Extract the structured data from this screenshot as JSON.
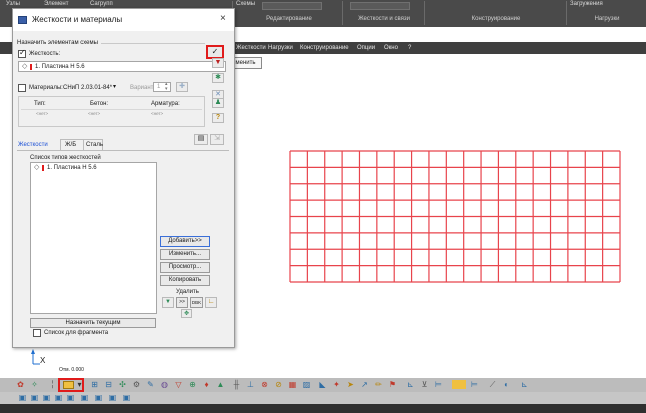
{
  "ribbon": {
    "menu": [
      "Узлы",
      "Элемент",
      "Сагрупп"
    ],
    "schemes_label": "Схемы",
    "loadings_label": "Загружения",
    "captions": [
      "Редактирование",
      "Жесткости и связи",
      "Конструирование",
      "Нагрузки"
    ]
  },
  "menubar": {
    "items": [
      "Жесткости",
      "Нагрузки",
      "Конструирование",
      "Опции",
      "Окно",
      "?"
    ]
  },
  "tooltip": {
    "text": "Применить"
  },
  "dialog": {
    "title": "Жесткости и материалы",
    "close_glyph": "×",
    "assign_section_label": "Назначить элементам схемы",
    "stiffness_checkbox_label": "Жесткость:",
    "stiffness_checked": true,
    "stiffness_field_value": "1. Пластина  H 5.6",
    "materials_checkbox_label": "Материалы:",
    "materials_checked": false,
    "norms_select_value": "СНиП 2.03.01-84*",
    "variant_label": "Вариант",
    "variant_value": "1",
    "materials_table": {
      "headers": [
        "Тип:",
        "Бетон:",
        "Арматура:"
      ],
      "values": [
        "<нет>",
        "<нет>",
        "<нет>"
      ]
    },
    "tabs": [
      "Жесткости",
      "Ж/Б",
      "Сталь"
    ],
    "active_tab": "Жесткости",
    "stiffness_list_label": "Список типов жесткостей",
    "stiffness_list": [
      "1. Пластина  H 5.6"
    ],
    "buttons": {
      "add": "Добавить>>",
      "edit": "Изменить...",
      "view": "Просмотр...",
      "copy": "Копировать",
      "delete": "Удалить",
      "assign_current": "Назначить текущим"
    },
    "mini_buttons": [
      ">>",
      "DBK"
    ],
    "fragment_list_label": "Список для фрагмента",
    "fragment_list_checked": false
  },
  "canvas": {
    "axis_x_label": "X",
    "origin_label": "Отм. 0.000",
    "mesh": {
      "color": "#e8444c",
      "columns": 19,
      "rows": 8
    }
  },
  "colors": {
    "accent_red": "#e01b1b",
    "ribbon_bg": "#4a4a4a",
    "dialog_bg": "#f0f0f0",
    "tab_active": "#1a4fd6"
  }
}
